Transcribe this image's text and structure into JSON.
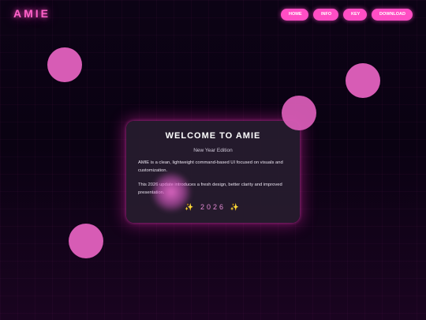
{
  "brand": {
    "name": "AMIE"
  },
  "nav": {
    "items": [
      {
        "label": "HOME"
      },
      {
        "label": "INFO"
      },
      {
        "label": "KEY"
      },
      {
        "label": "DOWNLOAD"
      }
    ]
  },
  "card": {
    "title": "WELCOME TO AMIE",
    "subtitle": "New Year Edition",
    "paragraph_1": "AMIE is a clean, lightweight command-based UI focused on visuals and customization.",
    "paragraph_2": "This 2026 update introduces a fresh design, better clarity and improved presentation.",
    "year": "2026",
    "sparkle_left": "✨",
    "sparkle_right": "✨"
  },
  "colors": {
    "accent": "#ff4ec4",
    "bubble": "#d75cb5",
    "background": "#0a0212",
    "card": "#261c2e"
  }
}
